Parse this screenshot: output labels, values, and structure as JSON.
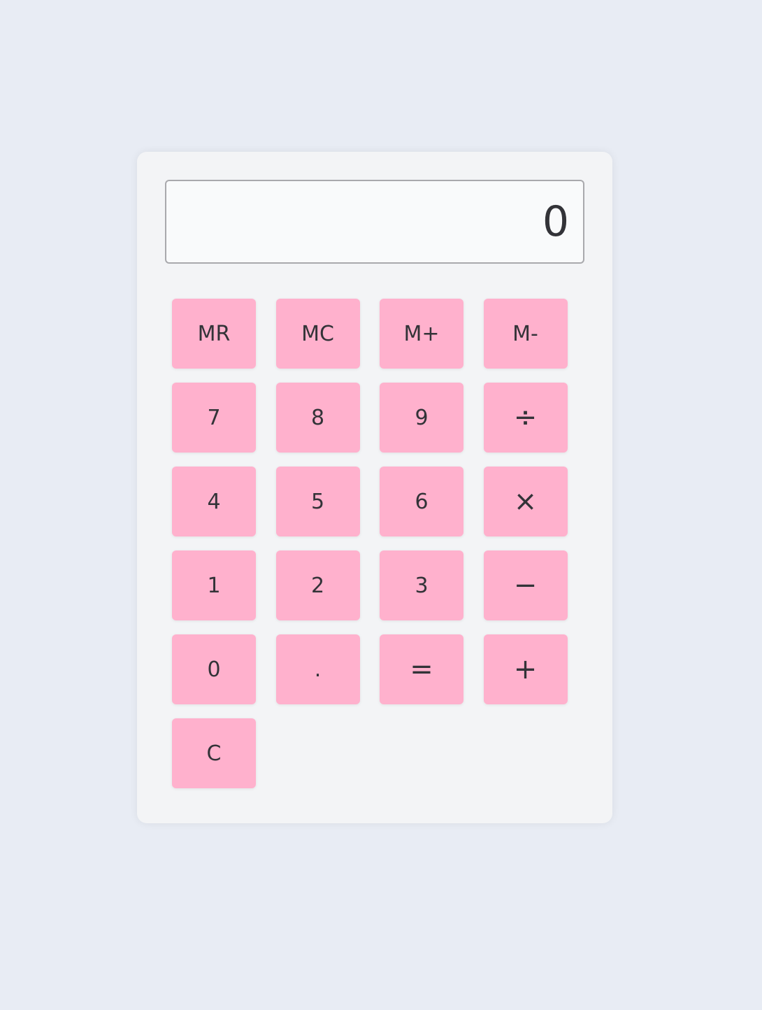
{
  "display": {
    "value": "0"
  },
  "keys": {
    "mr": "MR",
    "mc": "MC",
    "m_plus": "M+",
    "m_minus": "M-",
    "seven": "7",
    "eight": "8",
    "nine": "9",
    "divide": "÷",
    "four": "4",
    "five": "5",
    "six": "6",
    "multiply": "×",
    "one": "1",
    "two": "2",
    "three": "3",
    "subtract": "−",
    "zero": "0",
    "decimal": ".",
    "equals": "=",
    "add": "+",
    "clear": "C"
  },
  "colors": {
    "page_background": "#e8ecf4",
    "panel_background": "#f3f4f6",
    "display_background": "#f9fafb",
    "key_background": "#ffb1cd",
    "text": "#333338"
  }
}
